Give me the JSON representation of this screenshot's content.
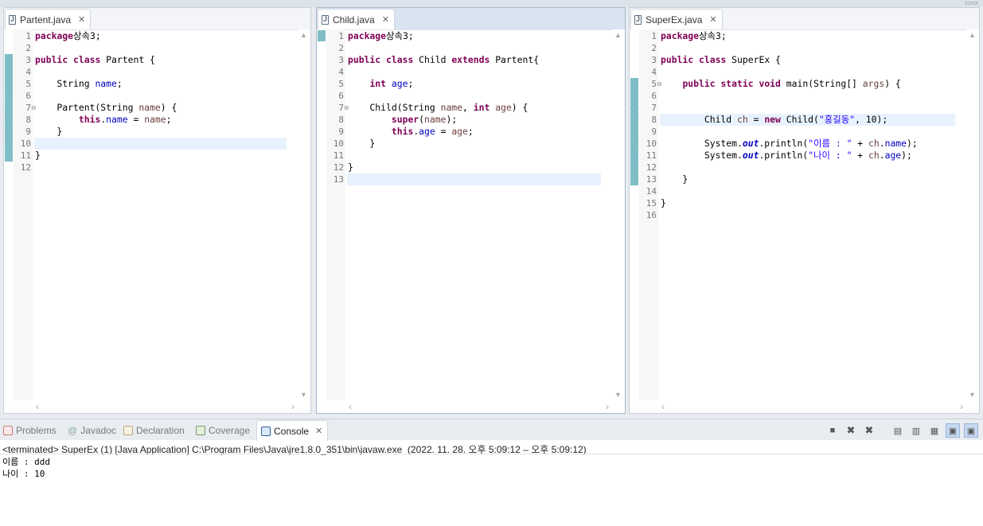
{
  "editors": [
    {
      "tab": "Partent.java",
      "lines": [
        {
          "n": "1",
          "segs": [
            [
              "kw",
              "package"
            ],
            [
              "",
              "상속3;"
            ]
          ]
        },
        {
          "n": "2",
          "segs": []
        },
        {
          "n": "3",
          "segs": [
            [
              "kw",
              "public"
            ],
            [
              "",
              " "
            ],
            [
              "kw",
              "class"
            ],
            [
              "",
              " Partent {"
            ]
          ]
        },
        {
          "n": "4",
          "segs": []
        },
        {
          "n": "5",
          "segs": [
            [
              "",
              "    String "
            ],
            [
              "fld",
              "name"
            ],
            [
              "",
              ";"
            ]
          ]
        },
        {
          "n": "6",
          "segs": []
        },
        {
          "n": "7",
          "segs": [
            [
              "",
              "    Partent(String "
            ],
            [
              "prm",
              "name"
            ],
            [
              "",
              ") {"
            ]
          ]
        },
        {
          "n": "8",
          "segs": [
            [
              "",
              "        "
            ],
            [
              "kw",
              "this"
            ],
            [
              "",
              "."
            ],
            [
              "fld",
              "name"
            ],
            [
              "",
              " = "
            ],
            [
              "prm",
              "name"
            ],
            [
              "",
              ";"
            ]
          ]
        },
        {
          "n": "9",
          "segs": [
            [
              "",
              "    }"
            ]
          ]
        },
        {
          "n": "10",
          "segs": []
        },
        {
          "n": "11",
          "segs": [
            [
              "",
              "}"
            ]
          ]
        },
        {
          "n": "12",
          "segs": []
        }
      ]
    },
    {
      "tab": "Child.java",
      "lines": [
        {
          "n": "1",
          "segs": [
            [
              "kw",
              "package"
            ],
            [
              "",
              "상속3;"
            ]
          ]
        },
        {
          "n": "2",
          "segs": []
        },
        {
          "n": "3",
          "segs": [
            [
              "kw",
              "public"
            ],
            [
              "",
              " "
            ],
            [
              "kw",
              "class"
            ],
            [
              "",
              " Child "
            ],
            [
              "kw",
              "extends"
            ],
            [
              "",
              " Partent{"
            ]
          ]
        },
        {
          "n": "4",
          "segs": []
        },
        {
          "n": "5",
          "segs": [
            [
              "",
              "    "
            ],
            [
              "kw",
              "int"
            ],
            [
              "",
              " "
            ],
            [
              "fld",
              "age"
            ],
            [
              "",
              ";"
            ]
          ]
        },
        {
          "n": "6",
          "segs": []
        },
        {
          "n": "7",
          "segs": [
            [
              "",
              "    Child(String "
            ],
            [
              "prm",
              "name"
            ],
            [
              "",
              ", "
            ],
            [
              "kw",
              "int"
            ],
            [
              "",
              " "
            ],
            [
              "prm",
              "age"
            ],
            [
              "",
              ") {"
            ]
          ]
        },
        {
          "n": "8",
          "segs": [
            [
              "",
              "        "
            ],
            [
              "kw",
              "super"
            ],
            [
              "",
              "("
            ],
            [
              "prm",
              "name"
            ],
            [
              "",
              ");"
            ]
          ]
        },
        {
          "n": "9",
          "segs": [
            [
              "",
              "        "
            ],
            [
              "kw",
              "this"
            ],
            [
              "",
              "."
            ],
            [
              "fld",
              "age"
            ],
            [
              "",
              " = "
            ],
            [
              "prm",
              "age"
            ],
            [
              "",
              ";"
            ]
          ]
        },
        {
          "n": "10",
          "segs": [
            [
              "",
              "    }"
            ]
          ]
        },
        {
          "n": "11",
          "segs": []
        },
        {
          "n": "12",
          "segs": [
            [
              "",
              "}"
            ]
          ]
        },
        {
          "n": "13",
          "segs": []
        }
      ]
    },
    {
      "tab": "SuperEx.java",
      "lines": [
        {
          "n": "1",
          "segs": [
            [
              "kw",
              "package"
            ],
            [
              "",
              "상속3;"
            ]
          ]
        },
        {
          "n": "2",
          "segs": []
        },
        {
          "n": "3",
          "segs": [
            [
              "kw",
              "public"
            ],
            [
              "",
              " "
            ],
            [
              "kw",
              "class"
            ],
            [
              "",
              " SuperEx {"
            ]
          ]
        },
        {
          "n": "4",
          "segs": []
        },
        {
          "n": "5",
          "segs": [
            [
              "",
              "    "
            ],
            [
              "kw",
              "public"
            ],
            [
              "",
              " "
            ],
            [
              "kw",
              "static"
            ],
            [
              "",
              " "
            ],
            [
              "kw",
              "void"
            ],
            [
              "",
              " main(String[] "
            ],
            [
              "prm",
              "args"
            ],
            [
              "",
              ") {"
            ]
          ]
        },
        {
          "n": "6",
          "segs": []
        },
        {
          "n": "7",
          "segs": []
        },
        {
          "n": "8",
          "segs": [
            [
              "",
              "        Child "
            ],
            [
              "prm",
              "ch"
            ],
            [
              "",
              " = "
            ],
            [
              "kw",
              "new"
            ],
            [
              "",
              " Child("
            ],
            [
              "str",
              "\"홍길동\""
            ],
            [
              "",
              ", 10);"
            ]
          ]
        },
        {
          "n": "9",
          "segs": []
        },
        {
          "n": "10",
          "segs": [
            [
              "",
              "        System."
            ],
            [
              "fs",
              "out"
            ],
            [
              "",
              ".println("
            ],
            [
              "str",
              "\"이름 : \""
            ],
            [
              "",
              " + "
            ],
            [
              "prm",
              "ch"
            ],
            [
              "",
              "."
            ],
            [
              "fld",
              "name"
            ],
            [
              "",
              ");"
            ]
          ]
        },
        {
          "n": "11",
          "segs": [
            [
              "",
              "        System."
            ],
            [
              "fs",
              "out"
            ],
            [
              "",
              ".println("
            ],
            [
              "str",
              "\"나이 : \""
            ],
            [
              "",
              " + "
            ],
            [
              "prm",
              "ch"
            ],
            [
              "",
              "."
            ],
            [
              "fld",
              "age"
            ],
            [
              "",
              ");"
            ]
          ]
        },
        {
          "n": "12",
          "segs": []
        },
        {
          "n": "13",
          "segs": [
            [
              "",
              "    }"
            ]
          ]
        },
        {
          "n": "14",
          "segs": []
        },
        {
          "n": "15",
          "segs": [
            [
              "",
              "}"
            ]
          ]
        },
        {
          "n": "16",
          "segs": []
        }
      ]
    }
  ],
  "console": {
    "tabs": [
      {
        "label": "Problems",
        "icon": "problems-icon"
      },
      {
        "label": "Javadoc",
        "icon": "javadoc-icon"
      },
      {
        "label": "Declaration",
        "icon": "declaration-icon"
      },
      {
        "label": "Coverage",
        "icon": "coverage-icon"
      },
      {
        "label": "Console",
        "icon": "console-icon"
      }
    ],
    "status": "<terminated> SuperEx (1) [Java Application] C:\\Program Files\\Java\\jre1.8.0_351\\bin\\javaw.exe  (2022. 11. 28. 오후 5:09:12 – 오후 5:09:12)",
    "output": [
      "이름 : ddd",
      "나이 : 10"
    ]
  }
}
